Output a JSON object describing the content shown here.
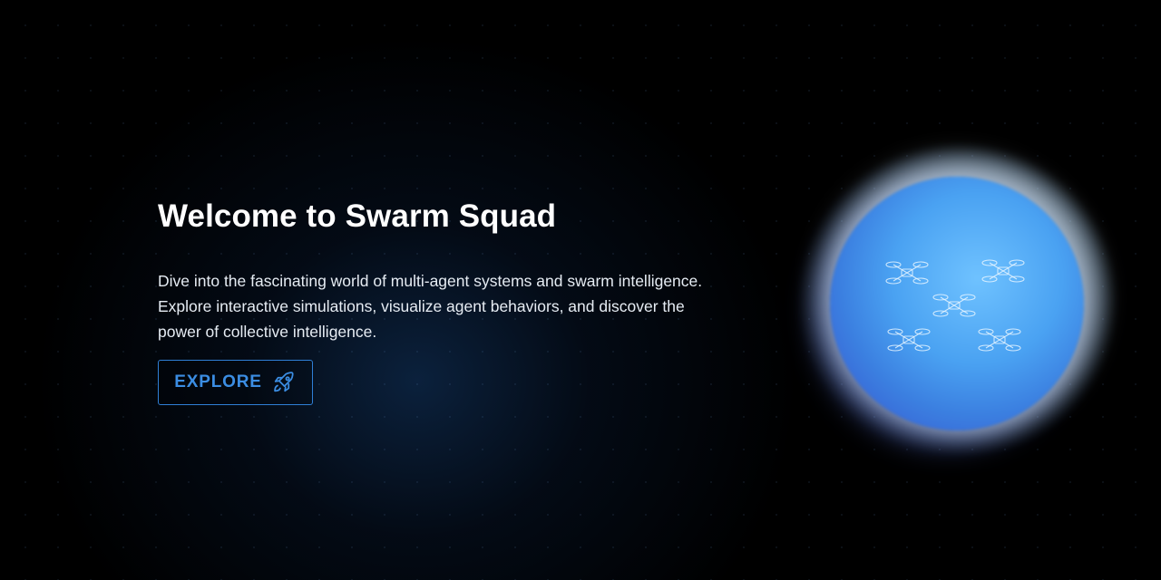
{
  "hero": {
    "title": "Welcome to Swarm Squad",
    "description": "Dive into the fascinating world of multi-agent systems and swarm intelligence. Explore interactive simulations, visualize agent behaviors, and discover the power of collective intelligence.",
    "explore_label": "EXPLORE"
  },
  "icons": {
    "explore": "rocket-icon",
    "orb_items": [
      "drone-icon",
      "drone-icon",
      "drone-icon",
      "drone-icon",
      "drone-icon"
    ]
  },
  "colors": {
    "background": "#000000",
    "accent": "#3b8de3",
    "title": "#ffffff",
    "orb_core": "#4aa2f2"
  }
}
